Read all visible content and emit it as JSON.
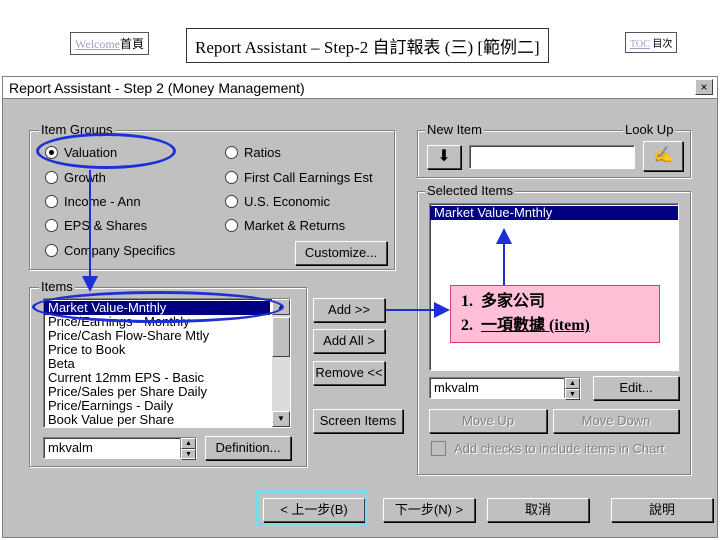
{
  "banner": {
    "welcome_link": "Welcome",
    "home_label": "首頁",
    "title": "Report Assistant – Step-2 自訂報表 (三) [範例二]",
    "toc_link": "TOC",
    "toc_label": "目次"
  },
  "window": {
    "title": "Report Assistant - Step 2    (Money Management)",
    "close": "×"
  },
  "item_groups": {
    "label": "Item Groups",
    "options_left": [
      "Valuation",
      "Growth",
      "Income - Ann",
      "EPS & Shares",
      "Company Specifics"
    ],
    "options_right": [
      "Ratios",
      "First Call Earnings Est",
      "U.S. Economic",
      "Market & Returns"
    ],
    "selected": "Valuation",
    "customize_button": "Customize..."
  },
  "items": {
    "label": "Items",
    "list": [
      "Market Value-Mnthly",
      "Price/Earnings - Monthly",
      "Price/Cash Flow-Share Mtly",
      "Price to Book",
      "Beta",
      "Current 12mm EPS - Basic",
      "Price/Sales per Share Daily",
      "Price/Earnings - Daily",
      "Book Value per Share"
    ],
    "selected_index": 0,
    "code_value": "mkvalm",
    "definition_button": "Definition..."
  },
  "middle_buttons": {
    "add": "Add >>",
    "add_all": "Add All >",
    "remove": "Remove <<",
    "screen_items": "Screen Items"
  },
  "new_item": {
    "label": "New Item",
    "lookup_label": "Look Up",
    "value": ""
  },
  "selected_items": {
    "label": "Selected Items",
    "list": [
      "Market Value-Mnthly"
    ],
    "code_value": "mkvalm",
    "edit_button": "Edit...",
    "move_up": "Move Up",
    "move_down": "Move Down",
    "checkbox_label": "Add checks to include items in Chart"
  },
  "annotation": {
    "line1_num": "1.",
    "line1_text": "多家公司",
    "line2_num": "2.",
    "line2_text": "一項數據 (item)"
  },
  "footer": {
    "back": "< 上一步(B)",
    "next": "下一步(N) >",
    "cancel": "取消",
    "help": "說明"
  },
  "colors": {
    "annotation_blue": "#1e2fd6",
    "highlight_cyan": "#7fd8e8",
    "note_pink": "#ffbfd6",
    "selection_navy": "#000080"
  }
}
